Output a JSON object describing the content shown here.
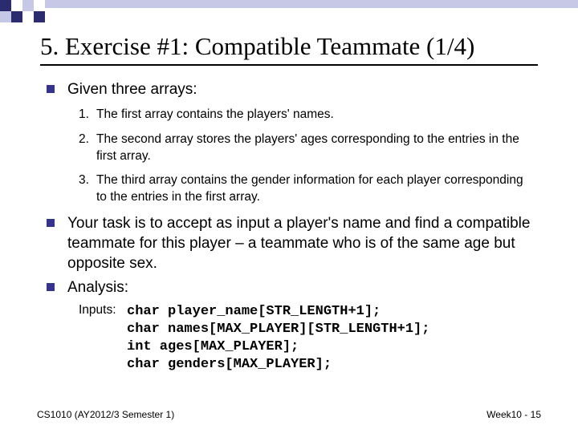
{
  "title": "5. Exercise #1: Compatible Teammate (1/4)",
  "bullets": {
    "b1": "Given three arrays:",
    "b2": "Your task is to accept as input a player's name and find a compatible teammate for this player – a teammate who is of the same age but opposite sex.",
    "b3": "Analysis:"
  },
  "numbered": {
    "n1": {
      "num": "1.",
      "text": "The first array contains the players' names."
    },
    "n2": {
      "num": "2.",
      "text": "The second array stores the players' ages corresponding to the entries in the first array."
    },
    "n3": {
      "num": "3.",
      "text": "The third array contains the gender information for each player corresponding to the entries in the first array."
    }
  },
  "inputs_label": "Inputs:",
  "code_lines": {
    "l1": "char player_name[STR_LENGTH+1];",
    "l2": "char names[MAX_PLAYER][STR_LENGTH+1];",
    "l3": "int ages[MAX_PLAYER];",
    "l4": "char genders[MAX_PLAYER];"
  },
  "footer": {
    "left": "CS1010 (AY2012/3 Semester 1)",
    "right": "Week10 - 15"
  },
  "deco_colors": {
    "dark": "#2b2b6f",
    "light": "#c7c7e6",
    "white": "#ffffff"
  }
}
